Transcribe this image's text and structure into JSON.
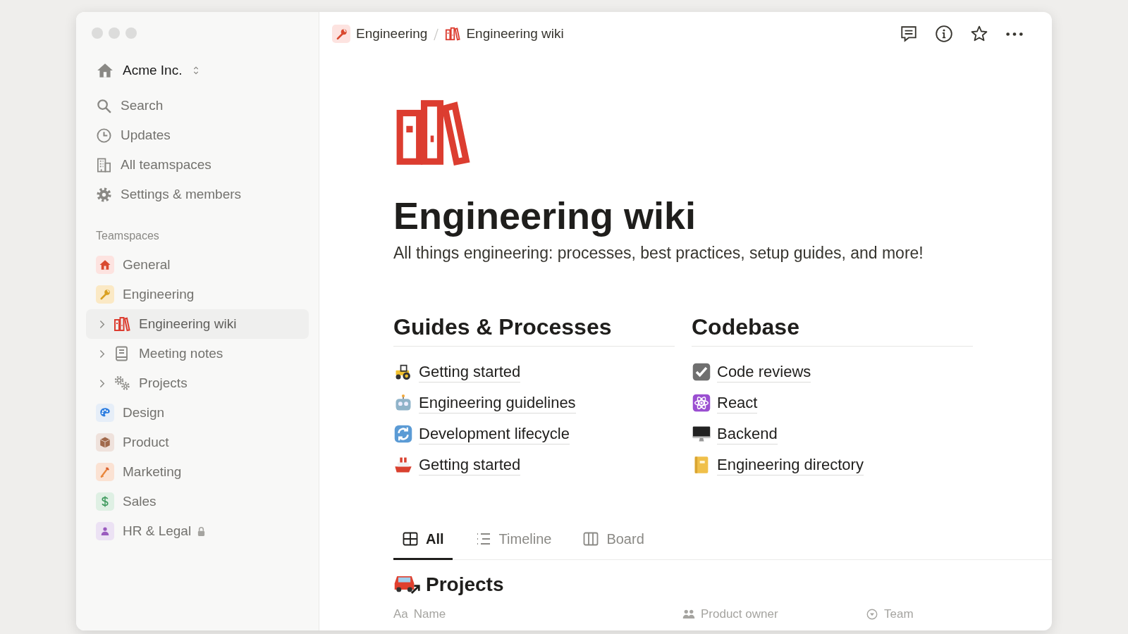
{
  "workspace": {
    "name": "Acme Inc.",
    "kind": "house"
  },
  "nav": [
    {
      "label": "Search",
      "kind": "search"
    },
    {
      "label": "Updates",
      "kind": "clock"
    },
    {
      "label": "All teamspaces",
      "kind": "building"
    },
    {
      "label": "Settings & members",
      "kind": "gear"
    }
  ],
  "teamspaces_label": "Teamspaces",
  "teamspaces": [
    {
      "label": "General",
      "kind": "house",
      "selected": false,
      "locked": false
    },
    {
      "label": "Engineering",
      "kind": "wrench",
      "selected": false,
      "locked": false,
      "children": [
        {
          "label": "Engineering wiki",
          "kind": "books",
          "selected": true,
          "expanded": false
        },
        {
          "label": "Meeting notes",
          "kind": "notes",
          "selected": false,
          "expanded": false
        },
        {
          "label": "Projects",
          "kind": "gears",
          "selected": false,
          "expanded": false
        }
      ]
    },
    {
      "label": "Design",
      "kind": "palette",
      "selected": false,
      "locked": false
    },
    {
      "label": "Product",
      "kind": "box",
      "selected": false,
      "locked": false
    },
    {
      "label": "Marketing",
      "kind": "pencil",
      "selected": false,
      "locked": false
    },
    {
      "label": "Sales",
      "kind": "dollar",
      "selected": false,
      "locked": false
    },
    {
      "label": "HR & Legal",
      "kind": "person",
      "selected": false,
      "locked": true
    }
  ],
  "breadcrumb": [
    {
      "label": "Engineering",
      "kind": "wrench"
    },
    {
      "label": "Engineering wiki",
      "kind": "books"
    }
  ],
  "page": {
    "kind": "books",
    "title": "Engineering wiki",
    "description": "All things engineering: processes, best practices, setup guides, and more!",
    "sections": [
      {
        "heading": "Guides & Processes",
        "links": [
          {
            "label": "Getting started",
            "kind": "tractor"
          },
          {
            "label": "Engineering guidelines",
            "kind": "robot"
          },
          {
            "label": "Development lifecycle",
            "kind": "cycle"
          },
          {
            "label": "Getting started",
            "kind": "ship"
          }
        ]
      },
      {
        "heading": "Codebase",
        "links": [
          {
            "label": "Code reviews",
            "kind": "check"
          },
          {
            "label": "React",
            "kind": "atom"
          },
          {
            "label": "Backend",
            "kind": "monitor"
          },
          {
            "label": "Engineering directory",
            "kind": "notebook"
          }
        ]
      }
    ],
    "view_tabs": [
      {
        "label": "All",
        "kind": "table",
        "selected": true
      },
      {
        "label": "Timeline",
        "kind": "timeline",
        "selected": false
      },
      {
        "label": "Board",
        "kind": "board",
        "selected": false
      }
    ],
    "database": {
      "title": "Projects",
      "kind": "car",
      "columns": [
        {
          "glyph": "Aa",
          "label": "Name"
        },
        {
          "kind": "people",
          "label": "Product owner"
        },
        {
          "kind": "status",
          "label": "Team"
        }
      ]
    }
  }
}
